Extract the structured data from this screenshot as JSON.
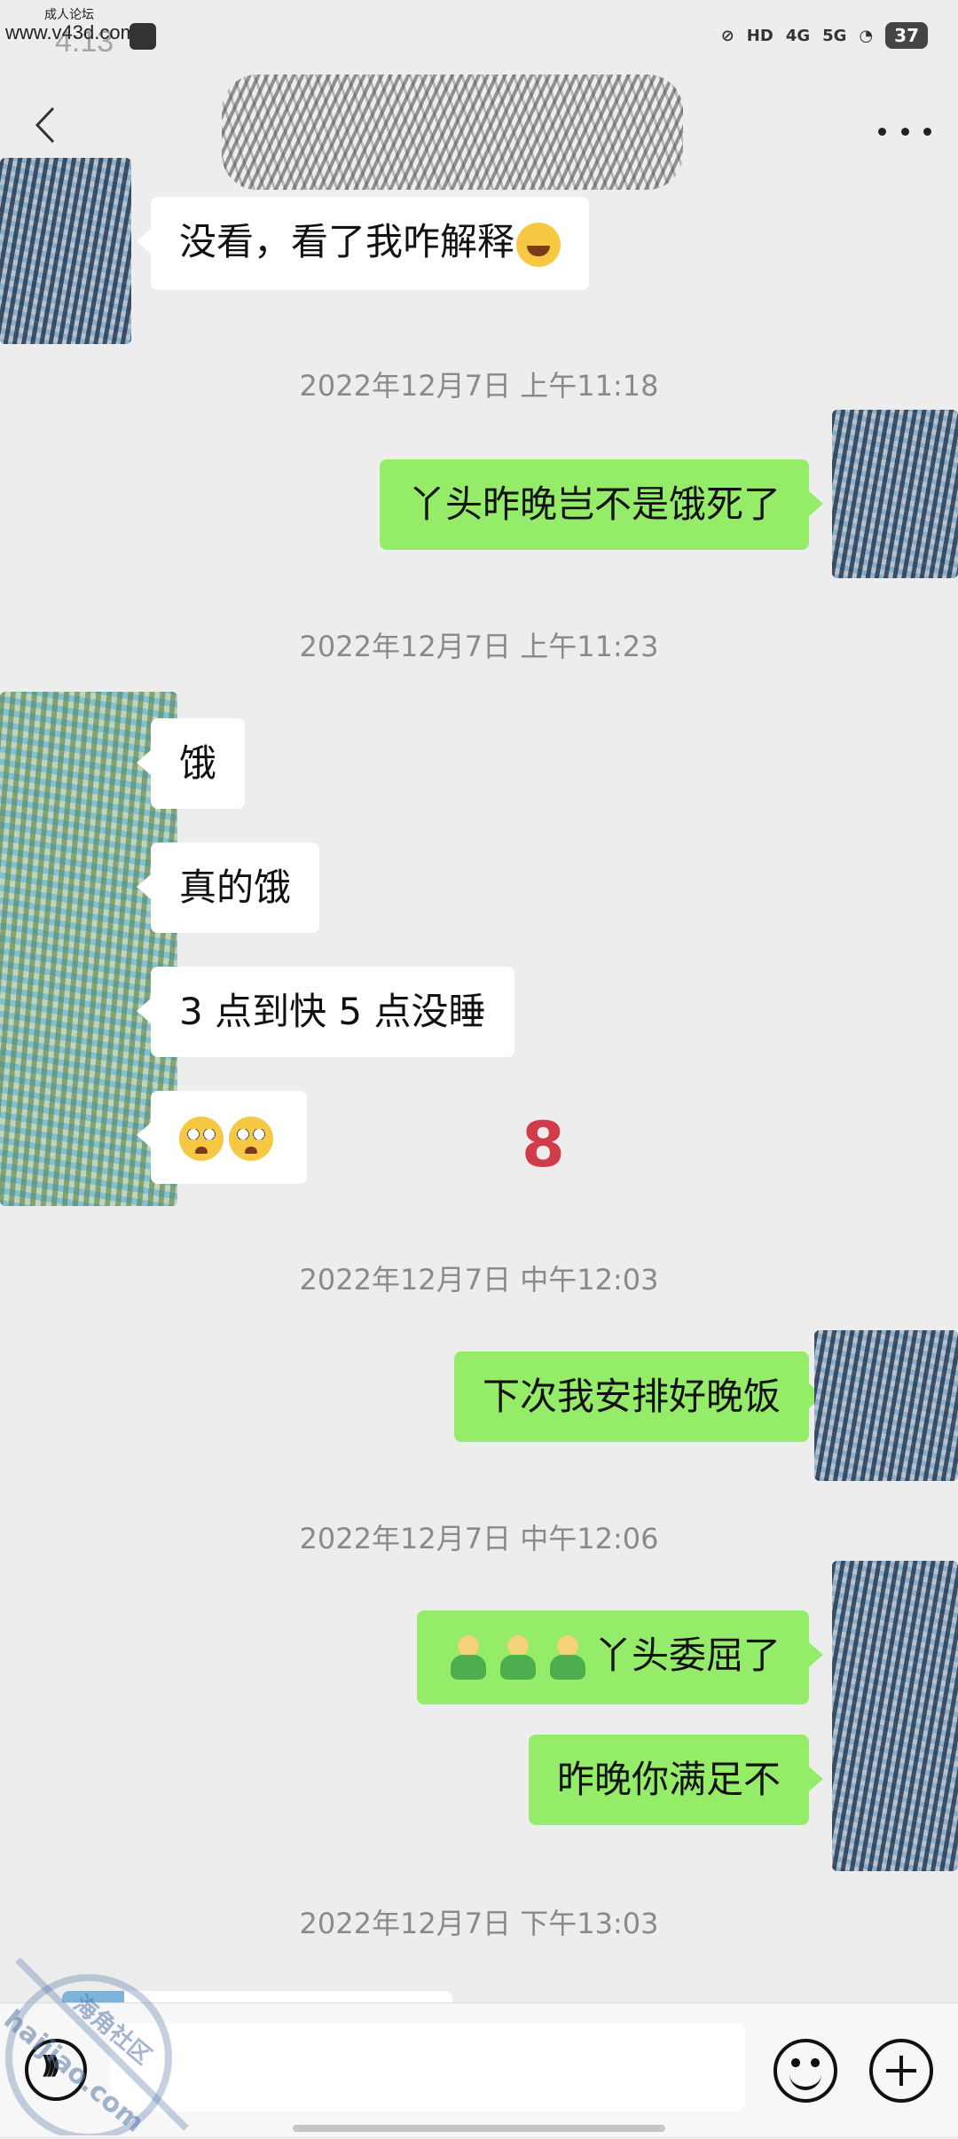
{
  "status_bar": {
    "time": "4:13",
    "watermark_top_small": "成人论坛",
    "watermark_url": "www.v43d.com",
    "hd_label": "HD",
    "signal_4g": "4G",
    "signal_5g": "5G",
    "battery": "37"
  },
  "header": {
    "back_icon": "chevron-left-icon",
    "more_icon": "more-dots-icon"
  },
  "messages": [
    {
      "side": "in",
      "text": "没看，看了我咋解释",
      "emoji": "laugh-cry"
    },
    {
      "type": "timestamp",
      "text": "2022年12月7日 上午11:18"
    },
    {
      "side": "out",
      "text": "丫头昨晚岂不是饿死了"
    },
    {
      "type": "timestamp",
      "text": "2022年12月7日 上午11:23"
    },
    {
      "side": "in",
      "text": "饿"
    },
    {
      "side": "in",
      "text": "真的饿"
    },
    {
      "side": "in",
      "text": "3 点到快 5 点没睡"
    },
    {
      "side": "in",
      "emoji": "crying-face x2"
    },
    {
      "type": "timestamp",
      "text": "2022年12月7日 中午12:03"
    },
    {
      "side": "out",
      "text": "下次我安排好晚饭"
    },
    {
      "type": "timestamp",
      "text": "2022年12月7日 中午12:06"
    },
    {
      "side": "out",
      "text": "丫头委屈了",
      "emoji": "doll x3"
    },
    {
      "side": "out",
      "text": "昨晚你满足不"
    },
    {
      "type": "timestamp",
      "text": "2022年12月7日 下午13:03"
    }
  ],
  "overlay_mark": "8",
  "watermark_stamp": {
    "line1": "海角社区",
    "line2": "haijiao.com"
  },
  "input_bar": {
    "placeholder": "",
    "voice_icon": "voice-icon",
    "emoji_icon": "smiley-icon",
    "plus_icon": "plus-icon"
  }
}
